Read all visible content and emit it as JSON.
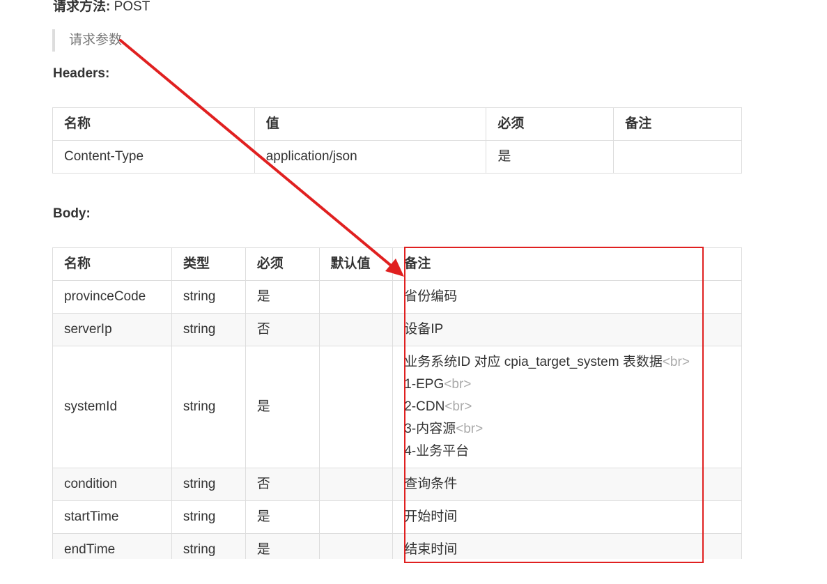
{
  "request": {
    "method_label": "请求方法:",
    "method_value": "POST",
    "params_quote": "请求参数"
  },
  "headers": {
    "title": "Headers:",
    "columns": [
      "名称",
      "值",
      "必须",
      "备注"
    ],
    "rows": [
      [
        "Content-Type",
        "application/json",
        "是",
        ""
      ]
    ]
  },
  "body": {
    "title": "Body:",
    "columns": [
      "名称",
      "类型",
      "必须",
      "默认值",
      "备注"
    ],
    "rows": [
      {
        "name": "provinceCode",
        "type": "string",
        "required": "是",
        "default": "",
        "remark": [
          "省份编码"
        ]
      },
      {
        "name": "serverIp",
        "type": "string",
        "required": "否",
        "default": "",
        "remark": [
          "设备IP"
        ]
      },
      {
        "name": "systemId",
        "type": "string",
        "required": "是",
        "default": "",
        "remark": [
          "业务系统ID 对应 cpia_target_system 表数据",
          "1-EPG",
          "2-CDN",
          "3-内容源",
          "4-业务平台"
        ],
        "remark_suffix": "<br>"
      },
      {
        "name": "condition",
        "type": "string",
        "required": "否",
        "default": "",
        "remark": [
          "查询条件"
        ]
      },
      {
        "name": "startTime",
        "type": "string",
        "required": "是",
        "default": "",
        "remark": [
          "开始时间"
        ]
      },
      {
        "name": "endTime",
        "type": "string",
        "required": "是",
        "default": "",
        "remark": [
          "结束时间"
        ]
      }
    ]
  },
  "annotation": {
    "color": "#e02020"
  }
}
